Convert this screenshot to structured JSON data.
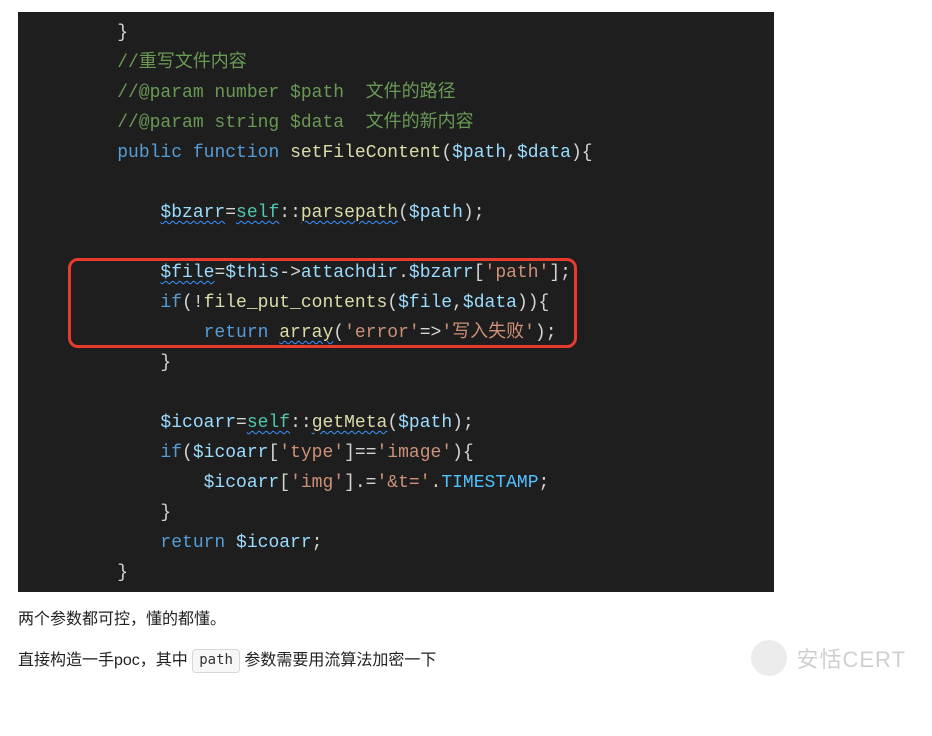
{
  "code": {
    "l1": "    }",
    "c1": "    //重写文件内容",
    "c2": "    //@param number $path  文件的路径",
    "c3": "    //@param string $data  文件的新内容",
    "kw_public": "public",
    "kw_function": "function",
    "fn_name": "setFileContent",
    "p_path": "$path",
    "p_data": "$data",
    "v_bzarr": "$bzarr",
    "kw_self1": "self",
    "fn_parsepath": "parsepath",
    "v_file": "$file",
    "v_this": "$this",
    "prop_attachdir": "attachdir",
    "v_bzarr2": "$bzarr",
    "s_path": "'path'",
    "kw_if1": "if",
    "fn_fpc": "file_put_contents",
    "kw_return1": "return",
    "fn_array": "array",
    "s_error": "'error'",
    "s_fail": "'写入失败'",
    "v_icoarr": "$icoarr",
    "kw_self2": "self",
    "fn_getmeta": "getMeta",
    "kw_if2": "if",
    "s_type": "'type'",
    "s_image": "'image'",
    "s_img": "'img'",
    "s_andt": "'&t='",
    "c_timestamp": "TIMESTAMP",
    "kw_return2": "return"
  },
  "article": {
    "p1": "两个参数都可控，懂的都懂。",
    "p2_a": "直接构造一手poc，其中 ",
    "p2_code": "path",
    "p2_b": " 参数需要用流算法加密一下"
  },
  "watermark": {
    "text": "安恬CERT"
  }
}
